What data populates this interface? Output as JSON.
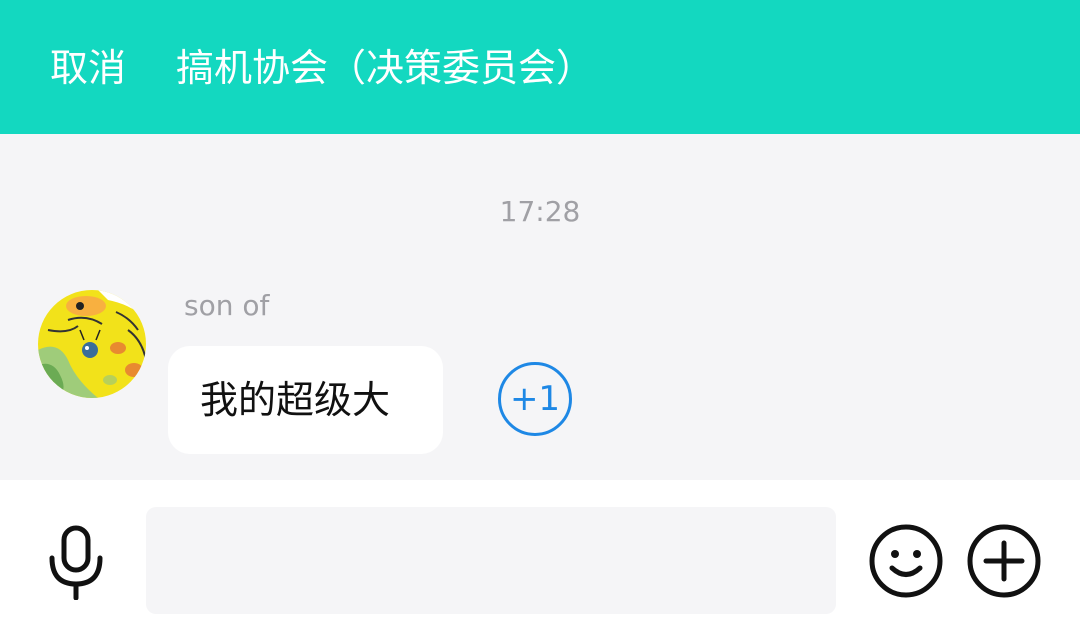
{
  "header": {
    "cancel_label": "取消",
    "title": "搞机协会（决策委员会）"
  },
  "chat": {
    "timestamp": "17:28",
    "message": {
      "sender": "son of",
      "text": "我的超级大",
      "plus_one_label": "+1"
    }
  },
  "input_bar": {
    "placeholder": "",
    "icons": [
      "microphone-icon",
      "emoji-icon",
      "plus-icon"
    ]
  },
  "colors": {
    "header_bg": "#13d8c0",
    "accent_blue": "#1e88e5",
    "chat_bg": "#f5f5f7"
  }
}
